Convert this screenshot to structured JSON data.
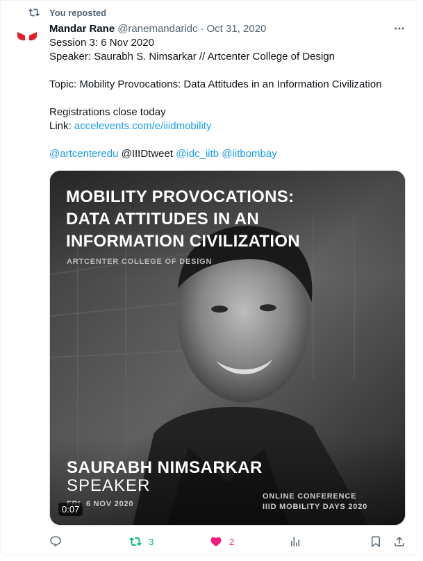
{
  "repost_label": "You reposted",
  "tweet": {
    "author_name": "Mandar Rane",
    "handle": "@ranemandaridc",
    "separator": "·",
    "date": "Oct 31, 2020",
    "lines": {
      "l1": "Session 3:  6 Nov 2020",
      "l2": "Speaker: Saurabh S. Nimsarkar // Artcenter College of Design",
      "l3": "Topic: Mobility Provocations: Data Attitudes in an Information Civilization",
      "l4": "Registrations close today",
      "link_prefix": "Link: ",
      "link_text": "accelevents.com/e/iiidmobility",
      "mention1": "@artcenteredu",
      "plain_mention": " @IIIDtweet ",
      "mention2": "@idc_iitb",
      "mention3": "@iitbombay"
    }
  },
  "media": {
    "title_lines": [
      "MOBILITY PROVOCATIONS:",
      "DATA ATTITUDES IN AN",
      "INFORMATION CIVILIZATION"
    ],
    "org": "ARTCENTER COLLEGE OF DESIGN",
    "speaker_name": "SAURABH NIMSARKAR",
    "speaker_role": "SPEAKER",
    "date": "FRI. 6 NOV 2020",
    "conference_line1": "ONLINE CONFERENCE",
    "conference_line2": "IIID MOBILITY DAYS 2020",
    "duration": "0:07"
  },
  "actions": {
    "reposts": "3",
    "likes": "2",
    "repost_color": "#00ba7c",
    "like_color": "#f91880",
    "icon_color": "#536471"
  },
  "colors": {
    "link": "#1d9bf0",
    "avatar_red": "#e0202a"
  }
}
